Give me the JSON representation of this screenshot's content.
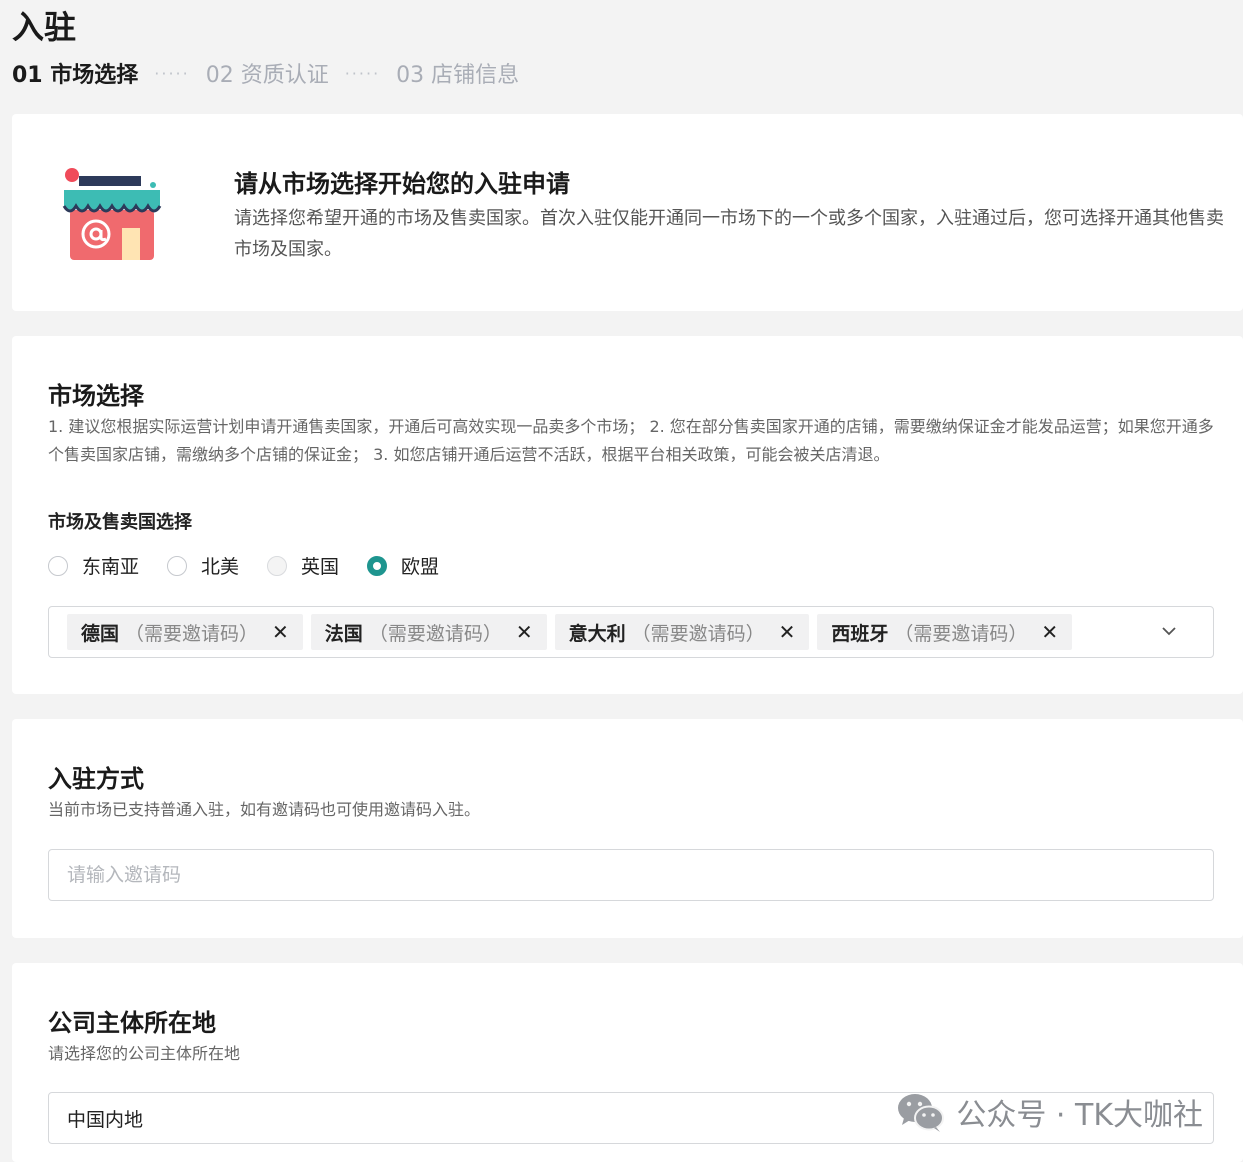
{
  "page": {
    "title": "入驻"
  },
  "steps": [
    {
      "label": "01 市场选择",
      "state": "active"
    },
    {
      "label": "02 资质认证",
      "state": "inactive"
    },
    {
      "label": "03 店铺信息",
      "state": "inactive"
    }
  ],
  "intro": {
    "icon": "shop-icon",
    "title": "请从市场选择开始您的入驻申请",
    "desc": "请选择您希望开通的市场及售卖国家。首次入驻仅能开通同一市场下的一个或多个国家，入驻通过后，您可选择开通其他售卖市场及国家。"
  },
  "market": {
    "title": "市场选择",
    "desc": "1. 建议您根据实际运营计划申请开通售卖国家，开通后可高效实现一品卖多个市场； 2. 您在部分售卖国家开通的店铺，需要缴纳保证金才能发品运营；如果您开通多个售卖国家店铺，需缴纳多个店铺的保证金； 3. 如您店铺开通后运营不活跃，根据平台相关政策，可能会被关店清退。",
    "sub_label": "市场及售卖国选择",
    "options": [
      {
        "label": "东南亚",
        "state": "unchecked"
      },
      {
        "label": "北美",
        "state": "unchecked"
      },
      {
        "label": "英国",
        "state": "disabled"
      },
      {
        "label": "欧盟",
        "state": "checked"
      }
    ],
    "tags": [
      {
        "name": "德国",
        "note": "（需要邀请码）"
      },
      {
        "name": "法国",
        "note": "（需要邀请码）"
      },
      {
        "name": "意大利",
        "note": "（需要邀请码）"
      },
      {
        "name": "西班牙",
        "note": "（需要邀请码）"
      }
    ],
    "tag_close": "✕"
  },
  "method": {
    "title": "入驻方式",
    "desc": "当前市场已支持普通入驻，如有邀请码也可使用邀请码入驻。",
    "input_placeholder": "请输入邀请码",
    "input_value": ""
  },
  "company": {
    "title": "公司主体所在地",
    "desc": "请选择您的公司主体所在地",
    "selected": "中国内地"
  },
  "watermark": {
    "text": "公众号 · TK大咖社",
    "icon": "wechat-icon"
  },
  "colors": {
    "accent": "#1e958f",
    "shop_red": "#f06a6e",
    "shop_teal": "#3dbcb4"
  }
}
